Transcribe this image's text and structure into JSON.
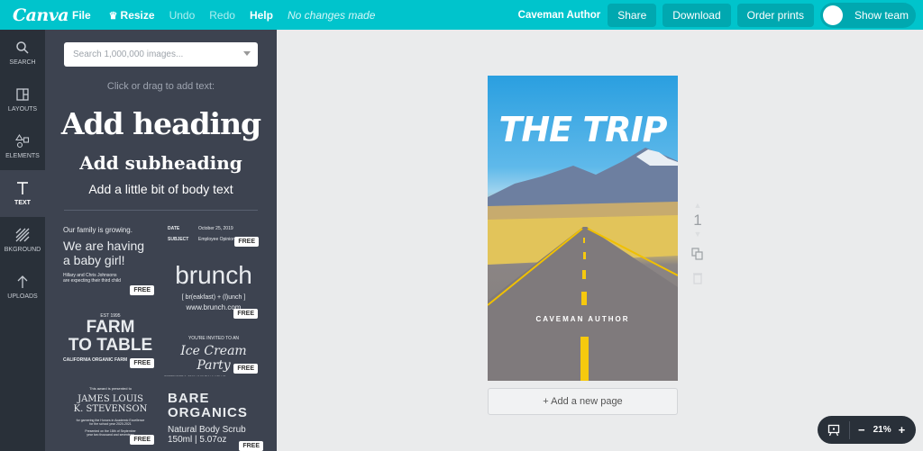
{
  "topbar": {
    "logo": "Canva",
    "menu": {
      "file": "File",
      "resize": "Resize",
      "undo": "Undo",
      "redo": "Redo",
      "help": "Help"
    },
    "status": "No changes made",
    "user": "Caveman Author",
    "share": "Share",
    "download": "Download",
    "order_prints": "Order prints",
    "show_team": "Show team",
    "colors": {
      "brand": "#00c4cc",
      "button": "#00a8b0"
    }
  },
  "sidebar": {
    "items": [
      {
        "label": "SEARCH",
        "icon": "search-icon"
      },
      {
        "label": "LAYOUTS",
        "icon": "layouts-icon"
      },
      {
        "label": "ELEMENTS",
        "icon": "elements-icon"
      },
      {
        "label": "TEXT",
        "icon": "text-icon",
        "active": true
      },
      {
        "label": "BKGROUND",
        "icon": "background-icon"
      },
      {
        "label": "UPLOADS",
        "icon": "upload-icon"
      }
    ]
  },
  "panel": {
    "search_placeholder": "Search 1,000,000 images...",
    "hint": "Click or drag to add text:",
    "add_heading": "Add heading",
    "add_subheading": "Add subheading",
    "add_body": "Add a little bit of body text",
    "free_label": "FREE",
    "templates": [
      {
        "lines": [
          "Our family is growing.",
          "We are having",
          "a baby girl!",
          "Hillary and Chris Johnsons",
          "are expecting their third child"
        ]
      },
      {
        "lines": [
          "DATE",
          "October 25, 2019",
          "SUBJECT",
          "Employee Opinion"
        ]
      },
      {
        "lines": [
          "brunch",
          "[ br(eakfast) + (l)unch ]",
          "www.brunch.com"
        ]
      },
      {
        "lines": [
          "EST 1995",
          "FARM",
          "TO TABLE",
          "CALIFORNIA ORGANIC FARM"
        ]
      },
      {
        "lines": [
          "YOU'RE INVITED TO AN",
          "Ice Cream Party",
          "SEPTEMBER 9, 2019 | 3:00 PM | 1 HOLLIS"
        ]
      },
      {
        "lines": [
          "This award is presented to",
          "JAMES LOUIS",
          "K. STEVENSON",
          "for garnering the Honors in Academic Excellence",
          "for the school year 2020-2021",
          "Presented on the 18th of September",
          "year two thousand and seventeen"
        ]
      },
      {
        "lines": [
          "BARE",
          "ORGANICS",
          "Natural Body Scrub",
          "150ml | 5.07oz"
        ]
      }
    ]
  },
  "canvas": {
    "title": "THE TRIP",
    "author": "CAVEMAN AUTHOR",
    "page_number": "1",
    "add_page": "+ Add a new page",
    "zoom": "21%",
    "zoom_minus": "−",
    "zoom_plus": "+"
  }
}
